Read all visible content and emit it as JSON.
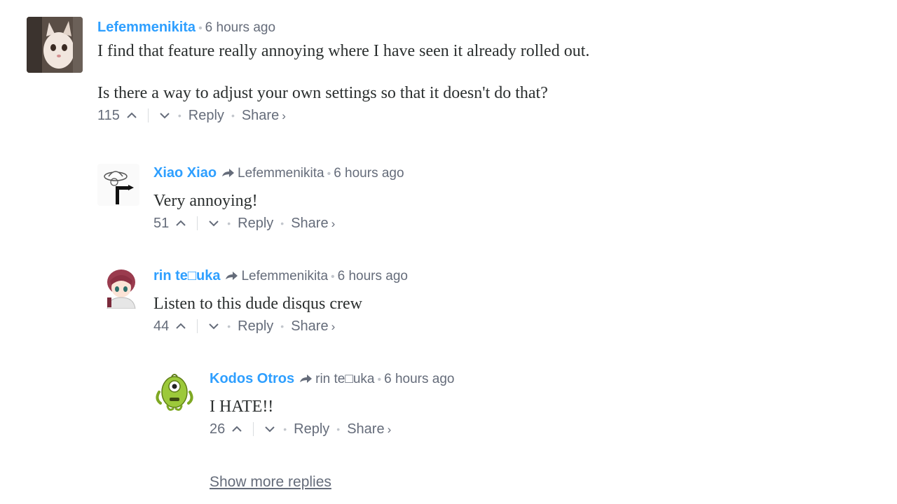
{
  "comments": [
    {
      "author": "Lefemmenikita",
      "parent": "",
      "sep": "•",
      "time": "6 hours ago",
      "paragraphs": [
        "I find that feature really annoying where I have seen it already rolled out.",
        "Is there a way to adjust your own settings so that it doesn't do that?"
      ],
      "votes": "115",
      "reply_label": "Reply",
      "share_label": "Share",
      "share_chevron": "›",
      "avatar_icon": "cat-avatar-icon"
    },
    {
      "author": "Xiao Xiao",
      "parent": "Lefemmenikita",
      "sep": "•",
      "time": "6 hours ago",
      "paragraphs": [
        "Very annoying!"
      ],
      "votes": "51",
      "reply_label": "Reply",
      "share_label": "Share",
      "share_chevron": "›",
      "avatar_icon": "sketch-avatar-icon"
    },
    {
      "author": "rin te□uka",
      "parent": "Lefemmenikita",
      "sep": "•",
      "time": "6 hours ago",
      "paragraphs": [
        "Listen to this dude disqus crew"
      ],
      "votes": "44",
      "reply_label": "Reply",
      "share_label": "Share",
      "share_chevron": "›",
      "avatar_icon": "anime-girl-avatar-icon"
    },
    {
      "author": "Kodos Otros",
      "parent": "rin te□uka",
      "sep": "•",
      "time": "6 hours ago",
      "paragraphs": [
        "I HATE!!"
      ],
      "votes": "26",
      "reply_label": "Reply",
      "share_label": "Share",
      "share_chevron": "›",
      "avatar_icon": "alien-avatar-icon"
    }
  ],
  "show_more_label": "Show more replies",
  "colors": {
    "author": "#2e9fff",
    "meta": "#656c7a",
    "text": "#2a2e2e"
  }
}
